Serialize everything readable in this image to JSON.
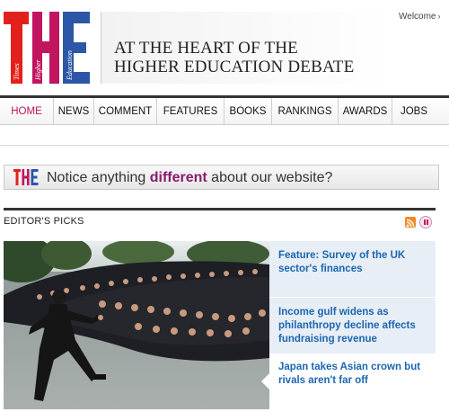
{
  "brand": {
    "logo_letters": "THE",
    "logo_words": [
      "Times",
      "Higher",
      "Education"
    ],
    "colors": {
      "t": "#e3211c",
      "h": "#c2155f",
      "e": "#2b57a6"
    }
  },
  "header": {
    "tagline_line1": "AT THE HEART OF THE",
    "tagline_line2": "HIGHER EDUCATION DEBATE",
    "welcome": "Welcome"
  },
  "nav": {
    "items": [
      {
        "label": "HOME",
        "active": true
      },
      {
        "label": "NEWS"
      },
      {
        "label": "COMMENT"
      },
      {
        "label": "FEATURES"
      },
      {
        "label": "BOOKS"
      },
      {
        "label": "RANKINGS"
      },
      {
        "label": "AWARDS"
      },
      {
        "label": "JOBS"
      }
    ]
  },
  "notice": {
    "logo": "THE",
    "text_before": "Notice anything ",
    "highlight": "different",
    "text_after": " about our website?"
  },
  "picks": {
    "title": "EDITOR'S PICKS",
    "icons": [
      "rss-icon",
      "pause-icon"
    ],
    "stories": [
      "Feature: Survey of the UK sector's finances",
      "Income gulf widens as philanthropy decline affects fundraising revenue",
      "Japan takes Asian crown but rivals aren't far off"
    ]
  }
}
